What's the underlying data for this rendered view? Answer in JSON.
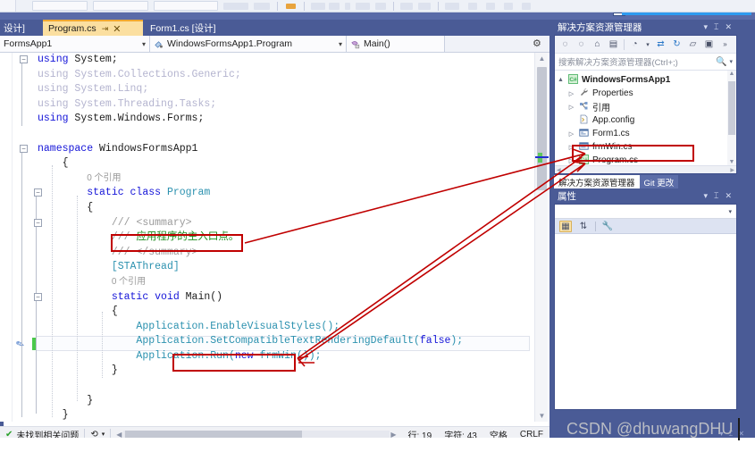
{
  "app": {
    "theme_blue": "#4a5b96",
    "accent_orange": "#f0a830",
    "annotation_red": "#c00000"
  },
  "tabs": {
    "cut_tab_label": "设计]",
    "active": {
      "name": "Program.cs",
      "pin_glyph": "⇥",
      "close_glyph": "✕"
    },
    "other": {
      "name": "Form1.cs [设计]"
    }
  },
  "navbar": {
    "project": "FormsApp1",
    "type": "WindowsFormsApp1.Program",
    "member": "Main()",
    "caret_glyph": "▾"
  },
  "code": {
    "lines": [
      {
        "tokens": [
          {
            "t": "using ",
            "c": "kw2"
          },
          {
            "t": "System;",
            "c": "txt"
          }
        ],
        "indent": 0,
        "fold": "minus"
      },
      {
        "tokens": [
          {
            "t": "using ",
            "c": "usd"
          },
          {
            "t": "System.Collections.Generic;",
            "c": "usd"
          }
        ],
        "indent": 0
      },
      {
        "tokens": [
          {
            "t": "using ",
            "c": "usd"
          },
          {
            "t": "System.Linq;",
            "c": "usd"
          }
        ],
        "indent": 0
      },
      {
        "tokens": [
          {
            "t": "using ",
            "c": "usd"
          },
          {
            "t": "System.Threading.Tasks;",
            "c": "usd"
          }
        ],
        "indent": 0
      },
      {
        "tokens": [
          {
            "t": "using ",
            "c": "kw2"
          },
          {
            "t": "System.Windows.Forms;",
            "c": "txt"
          }
        ],
        "indent": 0
      },
      {
        "tokens": [],
        "indent": 0
      },
      {
        "tokens": [
          {
            "t": "namespace ",
            "c": "kw2"
          },
          {
            "t": "WindowsFormsApp1",
            "c": "txt"
          }
        ],
        "indent": 0,
        "fold": "minus"
      },
      {
        "tokens": [
          {
            "t": "{",
            "c": "txt"
          }
        ],
        "indent": 1
      },
      {
        "tokens": [
          {
            "t": "0 个引用",
            "c": "ref"
          }
        ],
        "indent": 2
      },
      {
        "tokens": [
          {
            "t": "static class ",
            "c": "kw2"
          },
          {
            "t": "Program",
            "c": "tp"
          }
        ],
        "indent": 2,
        "fold": "minus"
      },
      {
        "tokens": [
          {
            "t": "{",
            "c": "txt"
          }
        ],
        "indent": 2
      },
      {
        "tokens": [
          {
            "t": "/// ",
            "c": "cmg"
          },
          {
            "t": "<summary>",
            "c": "cmg"
          }
        ],
        "indent": 3,
        "fold": "minus"
      },
      {
        "tokens": [
          {
            "t": "/// ",
            "c": "cmg"
          },
          {
            "t": "应用程序的主入口点。",
            "c": "cm"
          }
        ],
        "indent": 3
      },
      {
        "tokens": [
          {
            "t": "/// ",
            "c": "cmg"
          },
          {
            "t": "</summary>",
            "c": "cmg"
          }
        ],
        "indent": 3
      },
      {
        "tokens": [
          {
            "t": "[STAThread]",
            "c": "tp"
          }
        ],
        "indent": 3
      },
      {
        "tokens": [
          {
            "t": "0 个引用",
            "c": "ref"
          }
        ],
        "indent": 3
      },
      {
        "tokens": [
          {
            "t": "static void ",
            "c": "kw2"
          },
          {
            "t": "Main",
            "c": "txt"
          },
          {
            "t": "()",
            "c": "txt"
          }
        ],
        "indent": 3,
        "fold": "minus"
      },
      {
        "tokens": [
          {
            "t": "{",
            "c": "txt"
          }
        ],
        "indent": 3
      },
      {
        "tokens": [
          {
            "t": "Application",
            "c": "tp"
          },
          {
            "t": ".EnableVisualStyles();",
            "c": "tp"
          }
        ],
        "indent": 4
      },
      {
        "tokens": [
          {
            "t": "Application",
            "c": "tp"
          },
          {
            "t": ".SetCompatibleTextRenderingDefault(",
            "c": "tp"
          },
          {
            "t": "false",
            "c": "kw2"
          },
          {
            "t": ");",
            "c": "tp"
          }
        ],
        "indent": 4
      },
      {
        "tokens": [
          {
            "t": "Application",
            "c": "tp"
          },
          {
            "t": ".Run(",
            "c": "tp"
          },
          {
            "t": "new ",
            "c": "kw2"
          },
          {
            "t": "frmWin",
            "c": "tp"
          },
          {
            "t": "());",
            "c": "tp"
          }
        ],
        "indent": 4,
        "current": true
      },
      {
        "tokens": [
          {
            "t": "}",
            "c": "txt"
          }
        ],
        "indent": 3
      },
      {
        "tokens": [],
        "indent": 0
      },
      {
        "tokens": [
          {
            "t": "}",
            "c": "txt"
          }
        ],
        "indent": 2
      },
      {
        "tokens": [
          {
            "t": "}",
            "c": "txt"
          }
        ],
        "indent": 1
      }
    ]
  },
  "statusbar": {
    "issues": "未找到相关问题",
    "ok_glyph": "✔",
    "track_glyph": "⟲",
    "caret_glyph": "▾",
    "line": "行: 19",
    "column": "字符: 43",
    "encoding": "空格",
    "eol": "CRLF"
  },
  "solution_explorer": {
    "title": "解决方案资源管理器",
    "search_placeholder": "搜索解决方案资源管理器(Ctrl+;)",
    "toolbar_icons": [
      "back-arrow",
      "forward-arrow",
      "home",
      "sync-with-active-document",
      "pending-changes-filter",
      "refresh",
      "collapse-all",
      "show-all-files",
      "properties-window"
    ],
    "tree": [
      {
        "label": "WindowsFormsApp1",
        "icon": "csharp-project-icon",
        "expander": "▲",
        "level": 0,
        "bold": true
      },
      {
        "label": "Properties",
        "icon": "wrench-icon",
        "expander": "▷",
        "level": 1,
        "bold": false
      },
      {
        "label": "引用",
        "icon": "references-icon",
        "expander": "▷",
        "level": 1,
        "bold": false
      },
      {
        "label": "App.config",
        "icon": "config-file-icon",
        "expander": "",
        "level": 1,
        "bold": false
      },
      {
        "label": "Form1.cs",
        "icon": "form-file-icon",
        "expander": "▷",
        "level": 1,
        "bold": false
      },
      {
        "label": "frmWin.cs",
        "icon": "form-file-icon",
        "expander": "▷",
        "level": 1,
        "bold": false,
        "highlighted": true
      },
      {
        "label": "Program.cs",
        "icon": "csharp-file-icon",
        "expander": "▷",
        "level": 1,
        "bold": false
      }
    ],
    "dock_tabs": [
      {
        "label": "解决方案资源管理器",
        "active": true
      },
      {
        "label": "Git 更改",
        "active": false
      }
    ]
  },
  "properties_panel": {
    "title": "属性",
    "combo_value": "",
    "toolbar_icons": [
      "categorized-icon",
      "alphabetical-icon",
      "property-pages-icon"
    ],
    "caret_glyph": "▾",
    "pin_glyph": "⌶",
    "close_glyph": "✕"
  },
  "annotations": {
    "comment_box_target": "应用程序的主入口点。",
    "run_box_target": "Application.Run(new frmWin());",
    "tree_box_target": "frmWin.cs",
    "arrow_color": "#c00000"
  },
  "watermark": {
    "text": "CSDN @dhuwangDHU"
  }
}
